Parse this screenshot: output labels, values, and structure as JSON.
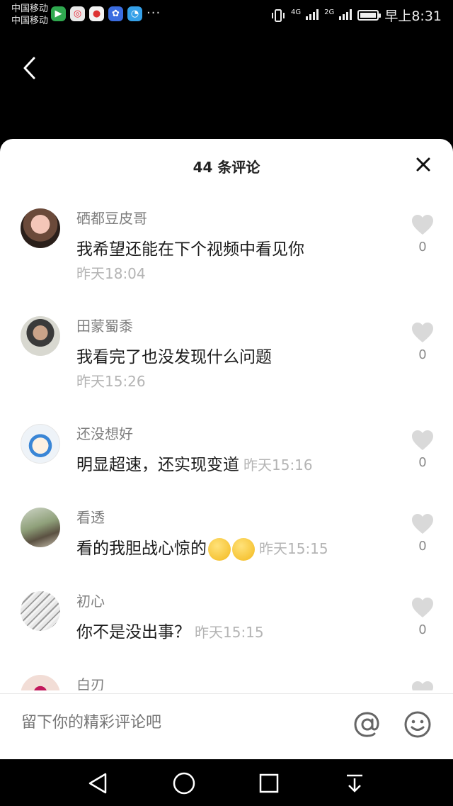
{
  "status_bar": {
    "carrier_1": "中国移动",
    "carrier_2": "中国移动",
    "more": "···",
    "network_4g": "4G",
    "network_2g": "2G",
    "time": "早上8:31"
  },
  "sheet": {
    "title": "44 条评论"
  },
  "comments": [
    {
      "user": "硒都豆皮哥",
      "text": "我希望还能在下个视频中看见你",
      "time": "昨天18:04",
      "likes": "0"
    },
    {
      "user": "田蒙蜀黍",
      "text": "我看完了也没发现什么问题",
      "time": "昨天15:26",
      "likes": "0"
    },
    {
      "user": "还没想好",
      "text": "明显超速，还实现变道",
      "time": "昨天15:16",
      "likes": "0"
    },
    {
      "user": "看透",
      "text": "看的我胆战心惊的",
      "time": "昨天15:15",
      "likes": "0"
    },
    {
      "user": "初心",
      "text": "你不是没出事？",
      "time": "昨天15:15",
      "likes": "0"
    },
    {
      "user": "白刃"
    }
  ],
  "composer": {
    "placeholder": "留下你的精彩评论吧"
  },
  "colors": {
    "background": "#000000",
    "sheet": "#ffffff",
    "heart": "#d9d9d9"
  }
}
